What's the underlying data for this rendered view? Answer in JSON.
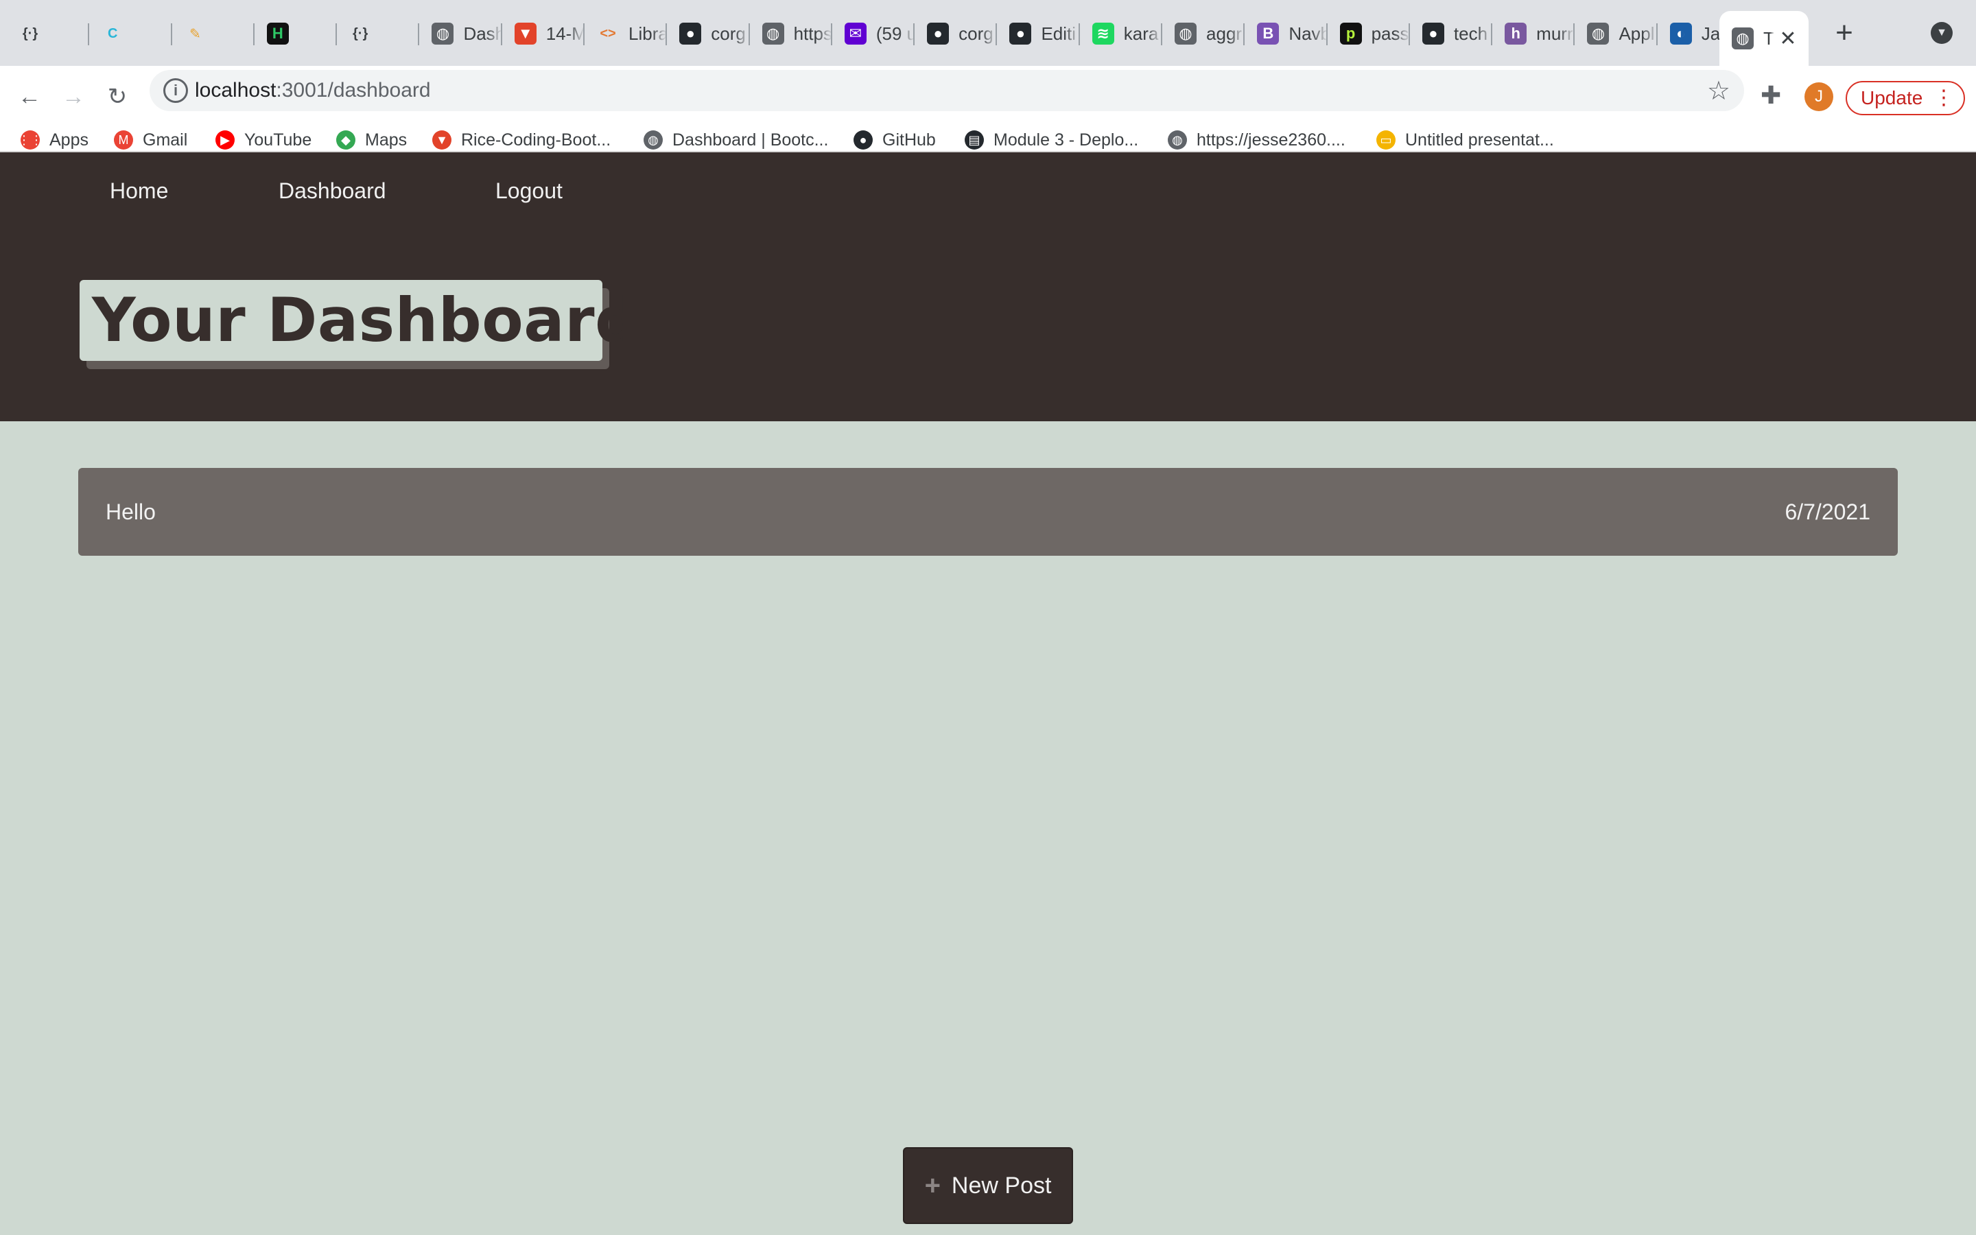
{
  "browser": {
    "tabs": [
      {
        "label": "",
        "icon": "curly-braces-icon",
        "bg": "#dfe1e5",
        "fg": "#3c4043"
      },
      {
        "label": "",
        "icon": "c-logo-icon",
        "bg": "#dfe1e5",
        "fg": "#29b6d8"
      },
      {
        "label": "",
        "icon": "feather-icon",
        "bg": "#dfe1e5",
        "fg": "#e8a22d"
      },
      {
        "label": "",
        "icon": "hackerrank-icon",
        "bg": "#111111",
        "fg": "#2ec866"
      },
      {
        "label": "",
        "icon": "curly-braces-icon",
        "bg": "#dfe1e5",
        "fg": "#3c4043"
      },
      {
        "label": "Dash",
        "icon": "globe-icon",
        "bg": "#5f6368",
        "fg": "#ffffff"
      },
      {
        "label": "14-M",
        "icon": "gitlab-icon",
        "bg": "#e2432a",
        "fg": "#ffffff"
      },
      {
        "label": "Libra",
        "icon": "code-brackets-icon",
        "bg": "#dfe1e5",
        "fg": "#e37933"
      },
      {
        "label": "corg",
        "icon": "github-icon",
        "bg": "#24292e",
        "fg": "#ffffff"
      },
      {
        "label": "https",
        "icon": "globe-icon",
        "bg": "#5f6368",
        "fg": "#ffffff"
      },
      {
        "label": "(59 u",
        "icon": "mail-icon",
        "bg": "#6001d2",
        "fg": "#ffffff"
      },
      {
        "label": "corg",
        "icon": "github-icon",
        "bg": "#24292e",
        "fg": "#ffffff"
      },
      {
        "label": "Editi",
        "icon": "github-icon",
        "bg": "#24292e",
        "fg": "#ffffff"
      },
      {
        "label": "kara",
        "icon": "spotify-icon",
        "bg": "#1ed760",
        "fg": "#ffffff"
      },
      {
        "label": "aggr",
        "icon": "globe-icon",
        "bg": "#5f6368",
        "fg": "#ffffff"
      },
      {
        "label": "Navb",
        "icon": "bootstrap-icon",
        "bg": "#7952b3",
        "fg": "#ffffff"
      },
      {
        "label": "pass",
        "icon": "p-logo-icon",
        "bg": "#111111",
        "fg": "#b6f23c"
      },
      {
        "label": "tech",
        "icon": "github-icon",
        "bg": "#24292e",
        "fg": "#ffffff"
      },
      {
        "label": "murr",
        "icon": "heroku-icon",
        "bg": "#79589f",
        "fg": "#ffffff"
      },
      {
        "label": "Appl",
        "icon": "globe-icon",
        "bg": "#5f6368",
        "fg": "#ffffff"
      },
      {
        "label": "Jaws",
        "icon": "jaws-icon",
        "bg": "#1b5fa8",
        "fg": "#ffffff"
      }
    ],
    "active_tab": {
      "label": "T",
      "icon": "globe-icon"
    },
    "new_tab": "+",
    "url_host": "localhost",
    "url_path": ":3001/dashboard",
    "update_label": "Update",
    "avatar_letter": "J",
    "bookmarks": [
      {
        "label": "Apps",
        "icon": "apps-grid-icon",
        "color": "#ea4335"
      },
      {
        "label": "Gmail",
        "icon": "gmail-icon",
        "color": "#ea4335"
      },
      {
        "label": "YouTube",
        "icon": "youtube-icon",
        "color": "#ff0000"
      },
      {
        "label": "Maps",
        "icon": "maps-icon",
        "color": "#34a853"
      },
      {
        "label": "Rice-Coding-Boot...",
        "icon": "gitlab-icon",
        "color": "#e2432a"
      },
      {
        "label": "Dashboard | Bootc...",
        "icon": "globe-icon",
        "color": "#5f6368"
      },
      {
        "label": "GitHub",
        "icon": "github-icon",
        "color": "#24292e"
      },
      {
        "label": "Module 3 - Deplo...",
        "icon": "book-icon",
        "color": "#24292e"
      },
      {
        "label": "https://jesse2360....",
        "icon": "globe-icon",
        "color": "#5f6368"
      },
      {
        "label": "Untitled presentat...",
        "icon": "slides-icon",
        "color": "#f4b400"
      }
    ]
  },
  "site": {
    "nav": [
      "Home",
      "Dashboard",
      "Logout"
    ],
    "title": "Your Dashboard",
    "posts": [
      {
        "title": "Hello",
        "date": "6/7/2021"
      }
    ],
    "new_post_label": "New Post",
    "colors": {
      "header_bg": "#372e2c",
      "page_bg": "#ced9d1",
      "card_bg": "#6e6865"
    }
  }
}
